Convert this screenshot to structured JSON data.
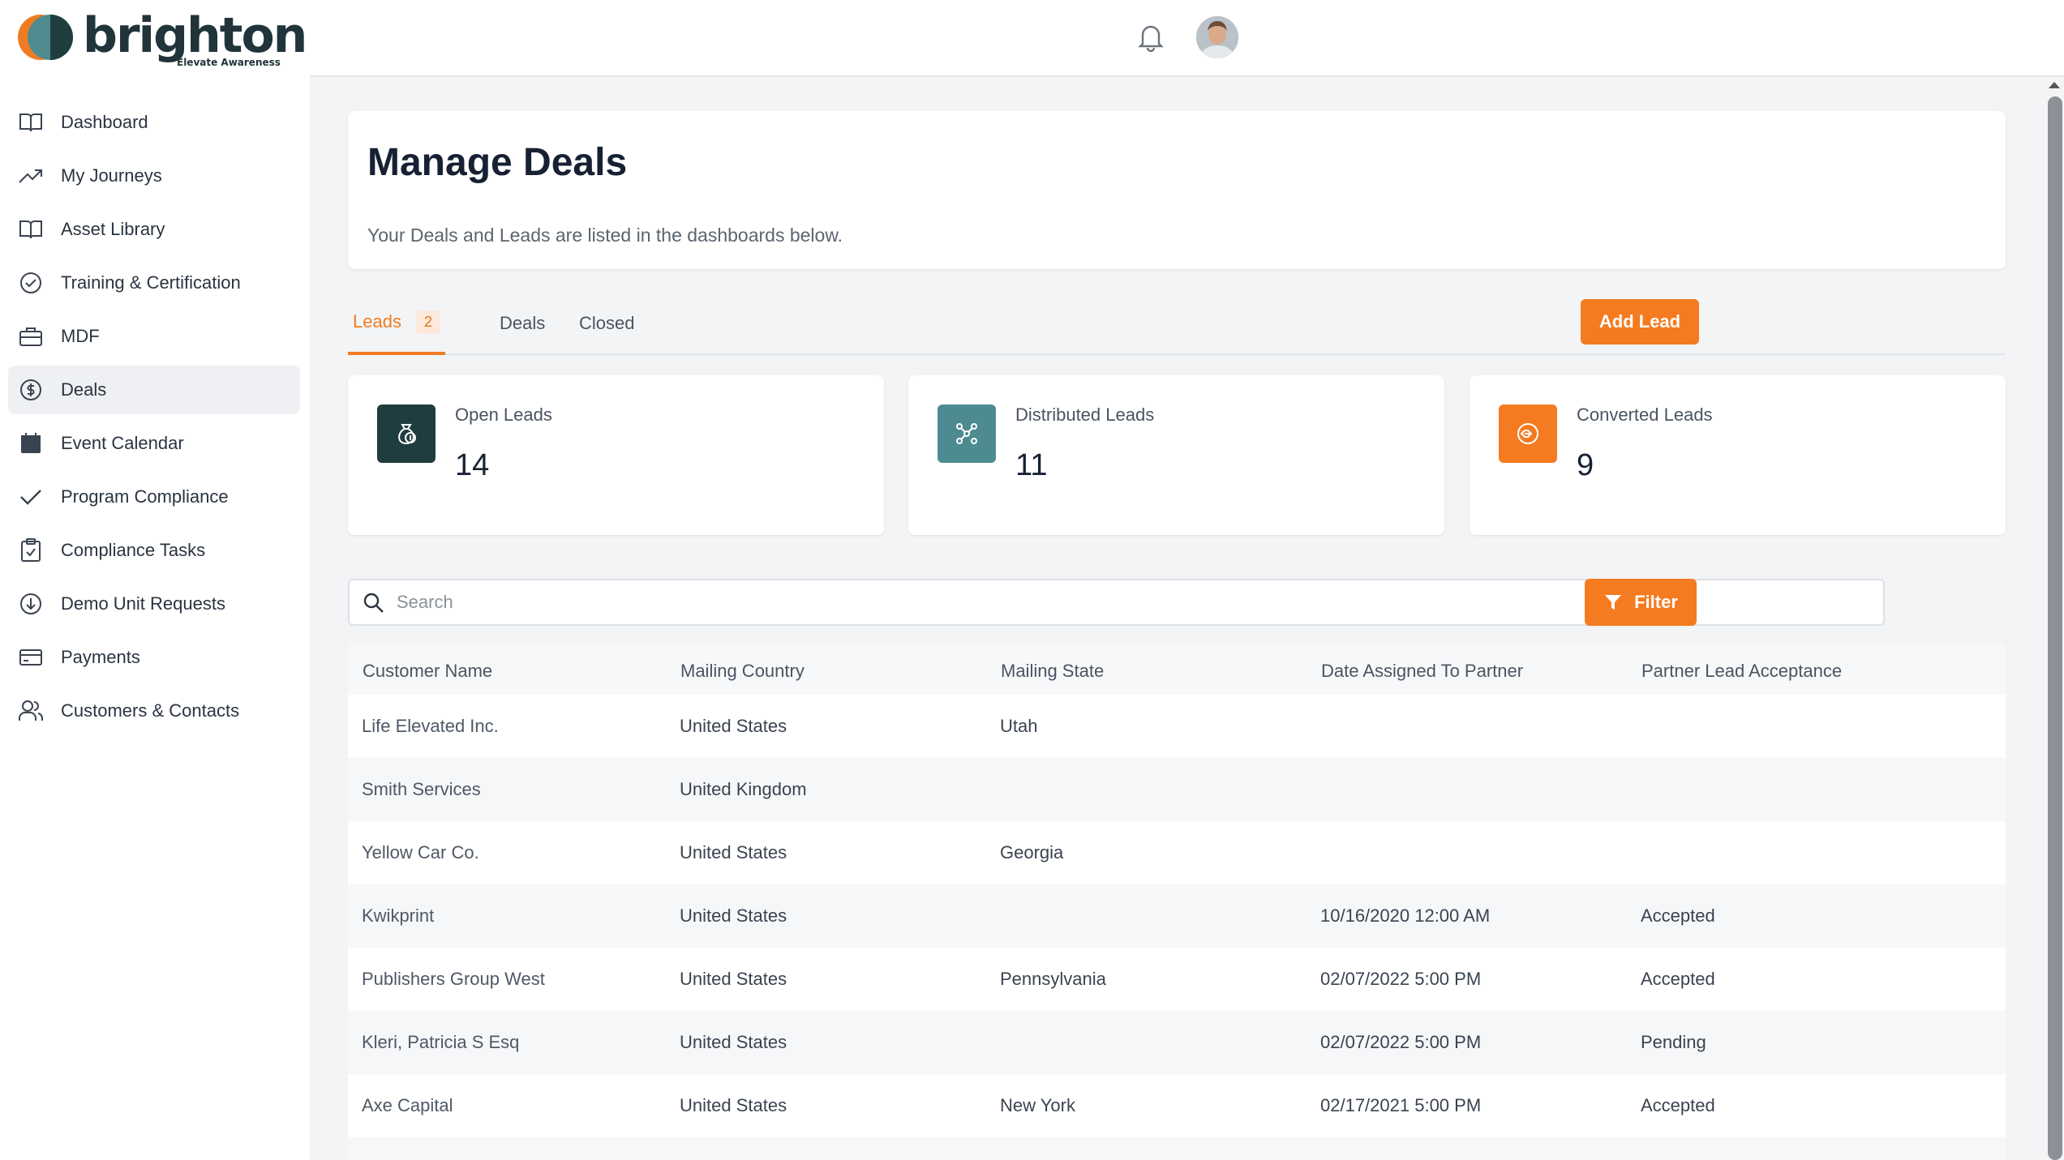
{
  "brand": {
    "name": "brighton",
    "tagline": "Elevate Awareness"
  },
  "sidebar": {
    "items": [
      {
        "label": "Dashboard",
        "icon": "book-icon",
        "active": false
      },
      {
        "label": "My Journeys",
        "icon": "trend-up-icon",
        "active": false
      },
      {
        "label": "Asset Library",
        "icon": "book-icon",
        "active": false
      },
      {
        "label": "Training & Certification",
        "icon": "check-circle-icon",
        "active": false
      },
      {
        "label": "MDF",
        "icon": "briefcase-icon",
        "active": false
      },
      {
        "label": "Deals",
        "icon": "dollar-circle-icon",
        "active": true
      },
      {
        "label": "Event Calendar",
        "icon": "calendar-icon",
        "active": false
      },
      {
        "label": "Program Compliance",
        "icon": "checkmark-icon",
        "active": false
      },
      {
        "label": "Compliance Tasks",
        "icon": "clipboard-check-icon",
        "active": false
      },
      {
        "label": "Demo Unit Requests",
        "icon": "download-circle-icon",
        "active": false
      },
      {
        "label": "Payments",
        "icon": "credit-card-icon",
        "active": false
      },
      {
        "label": "Customers & Contacts",
        "icon": "users-icon",
        "active": false
      }
    ]
  },
  "header": {
    "title": "Manage Deals",
    "subtitle": "Your Deals and Leads are listed in the dashboards below."
  },
  "tabs": [
    {
      "label": "Leads",
      "badge": "2",
      "active": true
    },
    {
      "label": "Deals",
      "badge": "",
      "active": false
    },
    {
      "label": "Closed",
      "badge": "",
      "active": false
    }
  ],
  "actions": {
    "add_lead": "Add Lead",
    "filter": "Filter"
  },
  "stats": [
    {
      "label": "Open Leads",
      "value": "14",
      "icon": "money-bag-icon",
      "color": "#1f3d3f"
    },
    {
      "label": "Distributed Leads",
      "value": "11",
      "icon": "distribute-icon",
      "color": "#4d8b91"
    },
    {
      "label": "Converted Leads",
      "value": "9",
      "icon": "handshake-icon",
      "color": "#f47b20"
    }
  ],
  "search": {
    "placeholder": "Search",
    "value": ""
  },
  "table": {
    "columns": [
      "Customer Name",
      "Mailing Country",
      "Mailing State",
      "Date Assigned To Partner",
      "Partner Lead Acceptance"
    ],
    "rows": [
      [
        "Life Elevated Inc.",
        "United States",
        "Utah",
        "",
        ""
      ],
      [
        "Smith Services",
        "United Kingdom",
        "",
        "",
        ""
      ],
      [
        "Yellow Car Co.",
        "United States",
        "Georgia",
        "",
        ""
      ],
      [
        "Kwikprint",
        "United States",
        "",
        "10/16/2020 12:00 AM",
        "Accepted"
      ],
      [
        "Publishers Group West",
        "United States",
        "Pennsylvania",
        "02/07/2022 5:00 PM",
        "Accepted"
      ],
      [
        "Kleri, Patricia S Esq",
        "United States",
        "",
        "02/07/2022 5:00 PM",
        "Pending"
      ],
      [
        "Axe Capital",
        "United States",
        "New York",
        "02/17/2021 5:00 PM",
        "Accepted"
      ]
    ]
  },
  "colors": {
    "accent": "#f47b20",
    "brand_dark": "#20343a",
    "brand_teal": "#4d8b91"
  }
}
